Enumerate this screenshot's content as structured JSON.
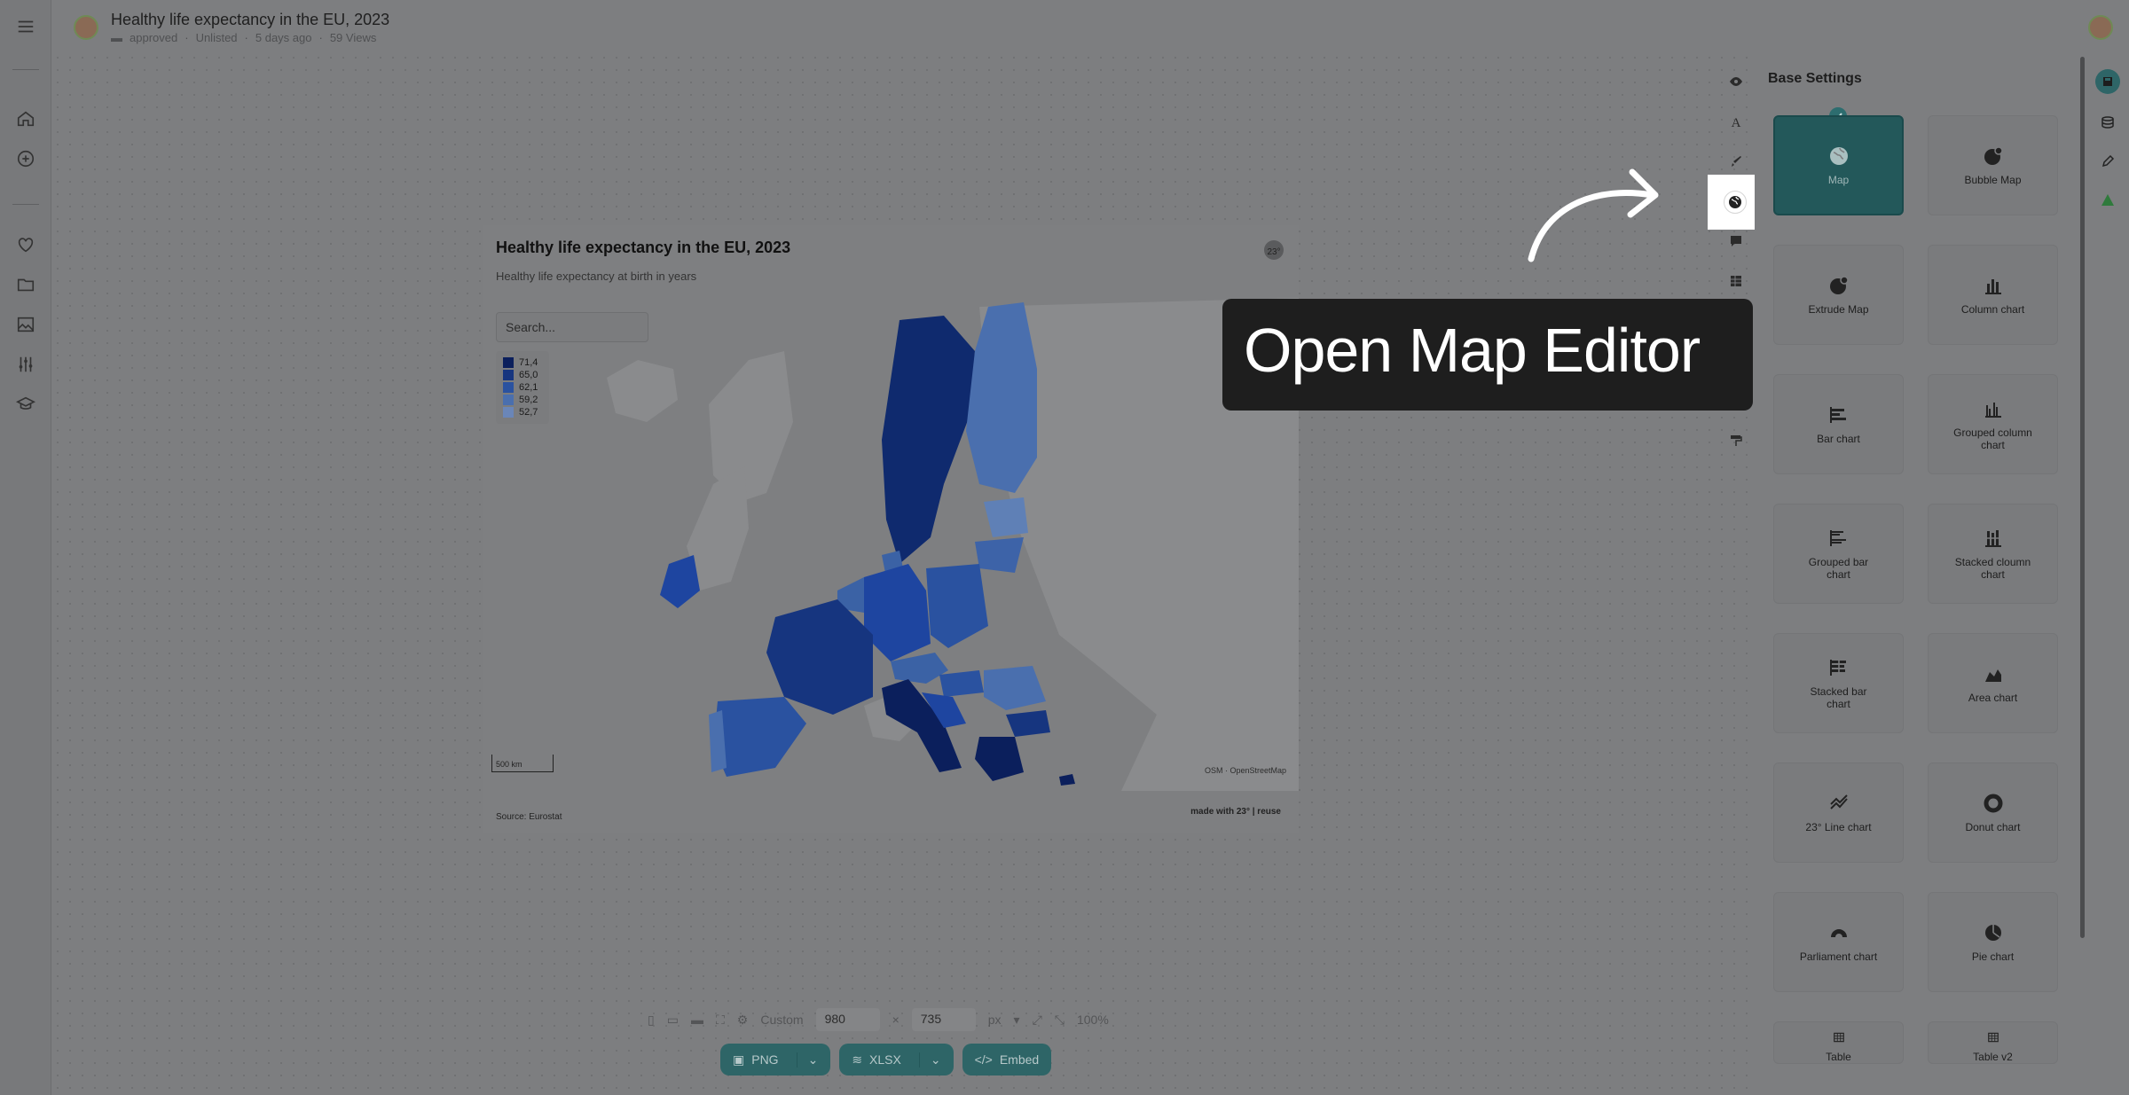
{
  "header": {
    "title": "Healthy life expectancy in the EU, 2023",
    "meta": [
      "approved",
      "Unlisted",
      "5 days ago",
      "59 Views"
    ]
  },
  "chart": {
    "title": "Healthy life expectancy in the EU, 2023",
    "subtitle": "Healthy life expectancy at birth in years",
    "search_placeholder": "Search...",
    "legend": [
      {
        "label": "71,4",
        "color": "#0b1f5c"
      },
      {
        "label": "65,0",
        "color": "#16357f"
      },
      {
        "label": "62,1",
        "color": "#2a52a0"
      },
      {
        "label": "59,2",
        "color": "#4a6fae"
      },
      {
        "label": "52,7",
        "color": "#6a86b8"
      }
    ],
    "scale": "500 km",
    "osm": "OSM · OpenStreetMap",
    "source": "Source: Eurostat",
    "made_with": "made with 23° | reuse"
  },
  "size_bar": {
    "preset": "Custom",
    "width": "980",
    "height": "735",
    "times": "×",
    "unit": "px",
    "zoom": "100%"
  },
  "export": {
    "png": "PNG",
    "xlsx": "XLSX",
    "embed": "Embed"
  },
  "callout": {
    "text": "Open Map Editor"
  },
  "panel": {
    "title": "Base Settings",
    "types": [
      {
        "label": "Map",
        "icon": "globe-icon"
      },
      {
        "label": "Bubble Map",
        "icon": "bubble-globe-icon"
      },
      {
        "label": "Extrude Map",
        "icon": "extrude-globe-icon"
      },
      {
        "label": "Column chart",
        "icon": "column-chart-icon"
      },
      {
        "label": "Bar chart",
        "icon": "bar-chart-icon"
      },
      {
        "label": "Grouped column chart",
        "icon": "grouped-column-icon"
      },
      {
        "label": "Grouped bar chart",
        "icon": "grouped-bar-icon"
      },
      {
        "label": "Stacked cloumn chart",
        "icon": "stacked-column-icon"
      },
      {
        "label": "Stacked bar chart",
        "icon": "stacked-bar-icon"
      },
      {
        "label": "Area chart",
        "icon": "area-chart-icon"
      },
      {
        "label": "23° Line chart",
        "icon": "line-chart-icon"
      },
      {
        "label": "Donut chart",
        "icon": "donut-chart-icon"
      },
      {
        "label": "Parliament chart",
        "icon": "parliament-chart-icon"
      },
      {
        "label": "Pie chart",
        "icon": "pie-chart-icon"
      },
      {
        "label": "Table",
        "icon": "table-icon"
      },
      {
        "label": "Table v2",
        "icon": "table-v2-icon"
      }
    ]
  },
  "colors": {
    "accent": "#2e6567",
    "callout_bg": "#1e1e1e"
  }
}
